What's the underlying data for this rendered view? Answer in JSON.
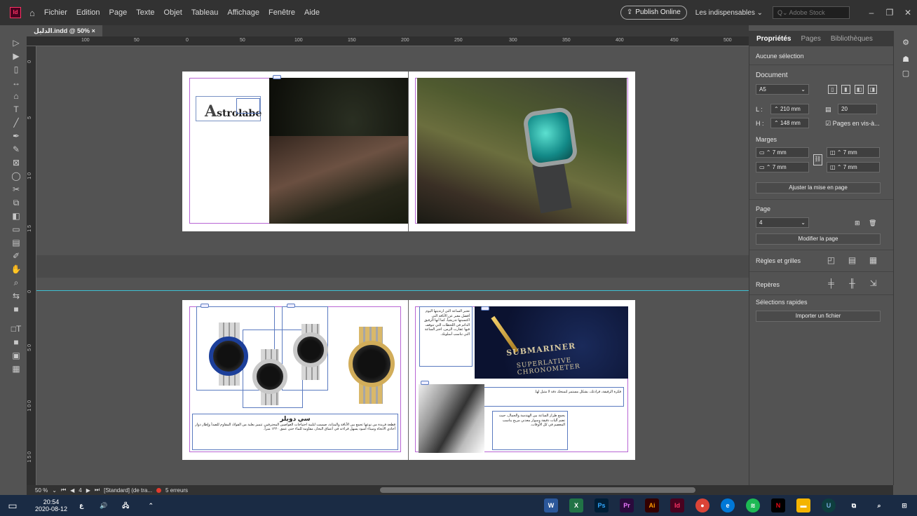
{
  "app": {
    "name": "Id",
    "menus": [
      "Fichier",
      "Edition",
      "Page",
      "Texte",
      "Objet",
      "Tableau",
      "Affichage",
      "Fenêtre",
      "Aide"
    ]
  },
  "header": {
    "publish_label": "Publish Online",
    "workspace": "Les indispensables",
    "stock_placeholder": "Adobe Stock"
  },
  "tab": {
    "title": "الدليل.indd @ 50%",
    "close": "×"
  },
  "ruler": {
    "h_ticks": [
      "100",
      "50",
      "0",
      "50",
      "100",
      "150",
      "200",
      "250",
      "300",
      "350",
      "400",
      "450",
      "500"
    ],
    "v_ticks": [
      "0",
      "5",
      "1 0",
      "1 5",
      "0",
      "5 0",
      "1 0 0",
      "1 5 0"
    ]
  },
  "spread1": {
    "logo": "strolabe",
    "logo_initial": "A"
  },
  "spread2": {
    "caption_title": "سي دويلر",
    "caption_body": "قطعة فريدة من نوعها تجمع بين الأناقة والمتانة، صممت لتلبية احتياجات الغواصين المحترفين. تتميز بعلبة من الفولاذ المقاوم للصدأ وإطار دوار أحادي الاتجاه وميناء أسود يسهل قراءته في أعماق البحار، مقاومة للماء حتى عمق ١٢٢٠ متراً.",
    "text_top": "تعتبر الساعة التي ارتديتها اليوم أفضل معبر عن الأناقة التي اكتسبتها تدريجياً، كما أنها الرفيق الدائم في اللحظات التي تتوقف فيها عقارب الزمن. اختر الساعة التي تناسب أسلوبك.",
    "text_mid": "فكرة الرفيقة، فرادتك، بشكل مستمر لتمنحك دقة لا مثيل لها.",
    "text_bottom": "يجمع طراز الساعة بين الهندسة والجمال، حيث تضم آليات دقيقة وسوار معدني مريح يناسب المعصم في كل الأوقات.",
    "dial_line1": "SUBMARINER",
    "dial_line2": "SUPERLATIVE CHRONOMETER"
  },
  "panel": {
    "tabs": [
      "Propriétés",
      "Pages",
      "Bibliothèques"
    ],
    "no_selection": "Aucune sélection",
    "document_label": "Document",
    "preset": "A5",
    "width_label": "L :",
    "width": "210 mm",
    "height_label": "H :",
    "height": "148 mm",
    "pages_count": "20",
    "facing_pages": "Pages en vis-à...",
    "margins_label": "Marges",
    "margin_top": "7 mm",
    "margin_bottom": "7 mm",
    "margin_left": "7 mm",
    "margin_right": "7 mm",
    "adjust_layout": "Ajuster la mise en page",
    "page_label": "Page",
    "page_value": "4",
    "modify_page": "Modifier la page",
    "rulers_grids": "Règles et grilles",
    "guides": "Repères",
    "quick_actions": "Sélections rapides",
    "import_file": "Importer un fichier"
  },
  "status": {
    "zoom": "50 %",
    "page": "4",
    "style": "[Standard] (de tra...",
    "errors": "5 erreurs"
  },
  "taskbar": {
    "time": "20:54",
    "date": "2020-08-12",
    "lang": "ع"
  },
  "colors": {
    "accent": "#ff3366",
    "guide": "#3ec1d3",
    "margin": "#b865d4",
    "frame": "#5a7ac0"
  }
}
